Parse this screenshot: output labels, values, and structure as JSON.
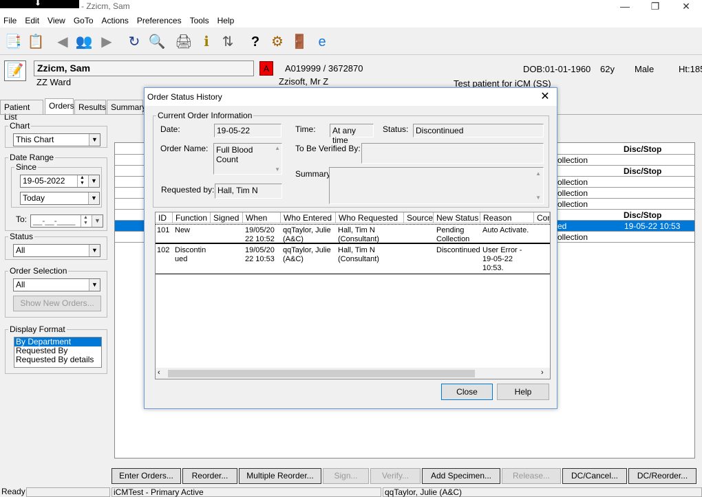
{
  "window": {
    "title": "- Zzicm, Sam",
    "logo_text": "⬇"
  },
  "menu": [
    "File",
    "Edit",
    "View",
    "GoTo",
    "Actions",
    "Preferences",
    "Tools",
    "Help"
  ],
  "patient": {
    "name": "Zzicm, Sam",
    "ward": "ZZ Ward",
    "alert": "A",
    "ids": "A019999 / 3672870",
    "consultant": "Zzisoft, Mr Z",
    "dob": "DOB:01-01-1960",
    "age": "62y",
    "sex": "Male",
    "height": "Ht:185",
    "note": "Test patient for iCM (SS)"
  },
  "tabs": [
    "Patient List",
    "Orders",
    "Results",
    "Summary"
  ],
  "left": {
    "chart_title": "Chart",
    "chart_value": "This Chart",
    "date_range_title": "Date Range",
    "since_label": "Since",
    "since_date": "19-05-2022",
    "since_value": "Today",
    "to_label": "To:",
    "to_value": "__-__-____",
    "status_title": "Status",
    "status_value": "All",
    "order_sel_title": "Order Selection",
    "order_sel_value": "All",
    "show_new_orders": "Show New Orders...",
    "display_format_title": "Display Format",
    "display_formats": [
      "By Department",
      "Requested By",
      "Requested By details"
    ]
  },
  "main": {
    "disc_stop": "Disc/Stop",
    "collection": "ollection",
    "selected_frag": "ed",
    "selected_time": "19-05-22 10:53"
  },
  "bottom_buttons": [
    "Enter Orders...",
    "Reorder...",
    "Multiple Reorder...",
    "Sign...",
    "Verify...",
    "Add Specimen...",
    "Release...",
    "DC/Cancel...",
    "DC/Reorder..."
  ],
  "statusbar": {
    "ready": "Ready",
    "env": "iCMTest - Primary Active",
    "user": "qqTaylor, Julie  (A&C)"
  },
  "dialog": {
    "title": "Order Status History",
    "group_title": "Current Order Information",
    "date_label": "Date:",
    "date_value": "19-05-22",
    "time_label": "Time:",
    "time_value": "At any time",
    "status_label": "Status:",
    "status_value": "Discontinued",
    "order_name_label": "Order Name:",
    "order_name_value": "Full Blood Count",
    "to_be_verified_label": "To Be Verified By:",
    "summary_label": "Summary:",
    "requested_by_label": "Requested by:",
    "requested_by_value": "Hall, Tim N",
    "columns": [
      "ID",
      "Function",
      "Signed",
      "When",
      "Who Entered",
      "Who Requested",
      "Source",
      "New Status",
      "Reason",
      "Cor"
    ],
    "rows": [
      {
        "id": "101",
        "function": "New",
        "signed": "",
        "when": "19/05/20\n22 10:52",
        "who_entered": "qqTaylor, Julie\n(A&C)",
        "who_requested": "Hall, Tim N\n(Consultant)",
        "source": "",
        "new_status": "Pending\nCollection",
        "reason": "Auto Activate."
      },
      {
        "id": "102",
        "function": "Discontin\nued",
        "signed": "",
        "when": "19/05/20\n22 10:53",
        "who_entered": "qqTaylor, Julie\n(A&C)",
        "who_requested": "Hall, Tim N\n(Consultant)",
        "source": "",
        "new_status": "Discontinued",
        "reason": "User Error -\n19-05-22\n10:53."
      }
    ],
    "close_label": "Close",
    "help_label": "Help"
  }
}
